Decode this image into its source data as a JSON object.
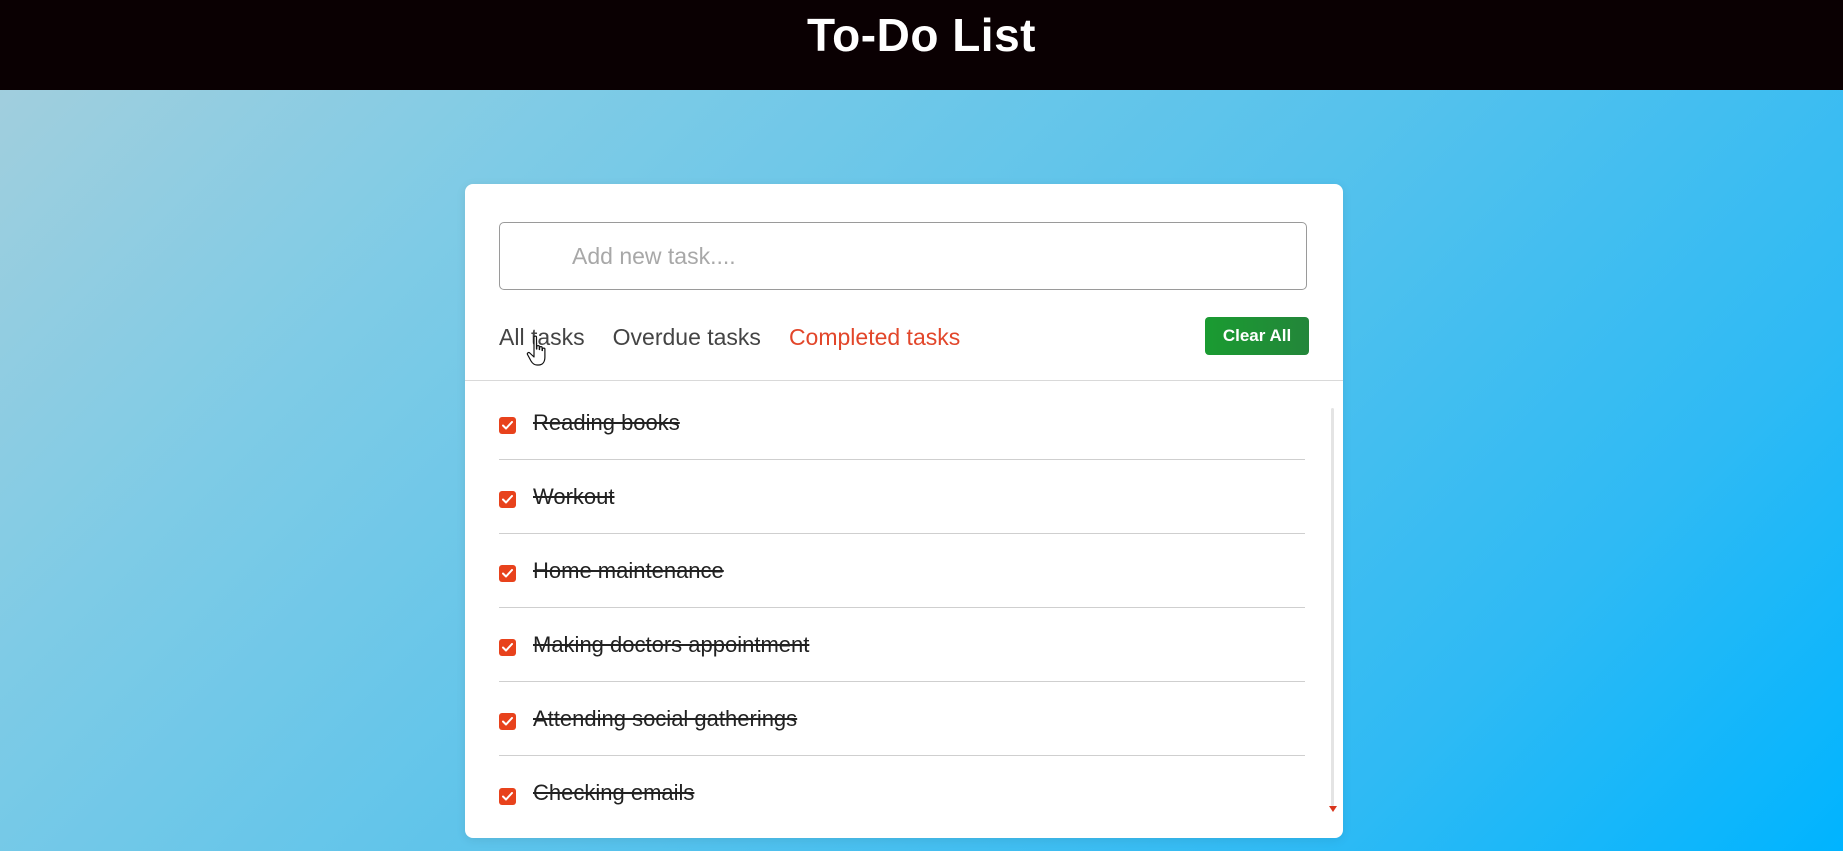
{
  "header": {
    "title": "To-Do List"
  },
  "input": {
    "placeholder": "Add new task...."
  },
  "filters": [
    {
      "label": "All tasks",
      "active": false
    },
    {
      "label": "Overdue tasks",
      "active": false
    },
    {
      "label": "Completed tasks",
      "active": true
    }
  ],
  "clear_button": {
    "label": "Clear All"
  },
  "tasks": [
    {
      "label": "Reading books",
      "completed": true
    },
    {
      "label": "Workout",
      "completed": true
    },
    {
      "label": "Home maintenance",
      "completed": true
    },
    {
      "label": "Making doctors appointment",
      "completed": true
    },
    {
      "label": "Attending social gatherings",
      "completed": true
    },
    {
      "label": "Checking emails",
      "completed": true
    }
  ],
  "colors": {
    "header_bg": "#0a0002",
    "accent": "#e2462a",
    "clear_button": "#1a9b31",
    "checkbox": "#e8421c"
  },
  "icons": {
    "checkbox": "check-icon",
    "cursor": "hand-pointer-icon"
  }
}
